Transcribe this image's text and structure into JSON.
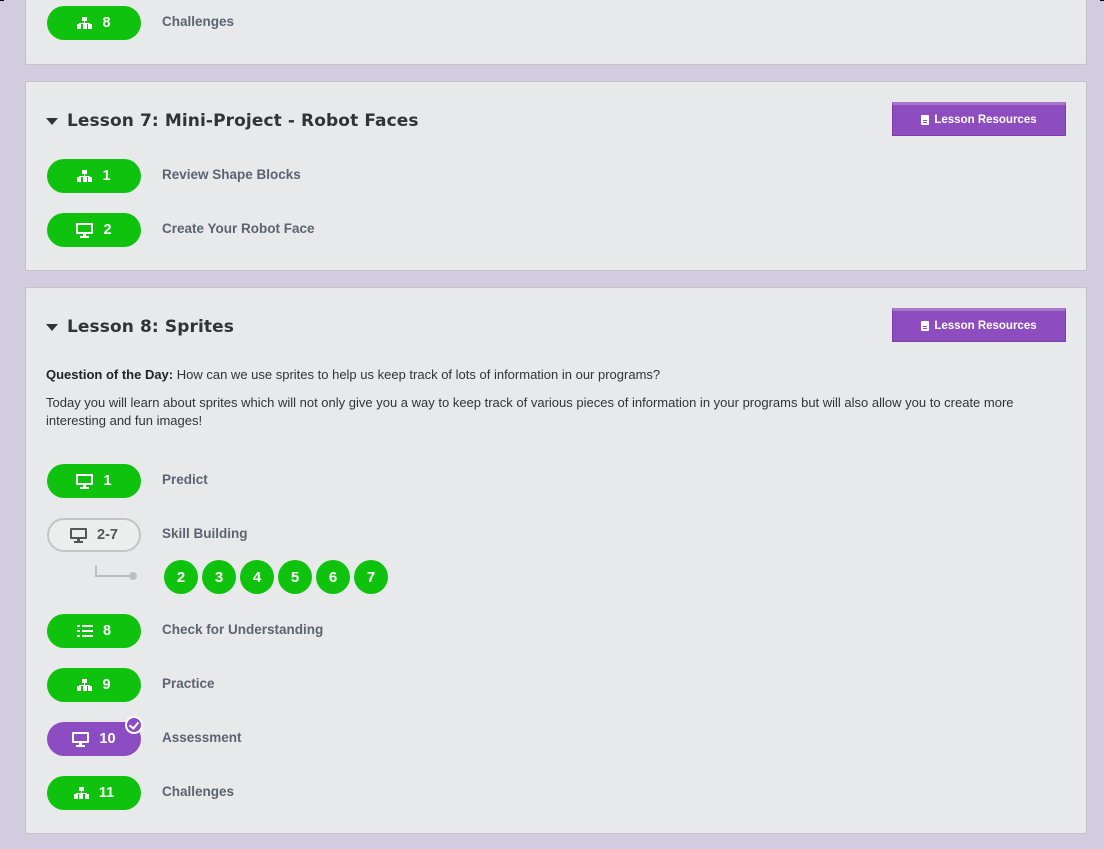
{
  "top_card": {
    "rows": [
      {
        "icon": "hierarchy-icon",
        "number": "8",
        "label": "Challenges"
      }
    ]
  },
  "lesson7": {
    "title": "Lesson 7: Mini-Project - Robot Faces",
    "resources_label": "Lesson Resources",
    "rows": [
      {
        "icon": "hierarchy-icon",
        "number": "1",
        "label": "Review Shape Blocks"
      },
      {
        "icon": "monitor-icon",
        "number": "2",
        "label": "Create Your Robot Face"
      }
    ]
  },
  "lesson8": {
    "title": "Lesson 8: Sprites",
    "resources_label": "Lesson Resources",
    "qotd_label": "Question of the Day:",
    "qotd_text": " How can we use sprites to help us keep track of lots of information in our programs?",
    "description": "Today you will learn about sprites which will not only give you a way to keep track of various pieces of information in your programs but will also allow you to create more interesting and fun images!",
    "rows": [
      {
        "icon": "monitor-icon",
        "number": "1",
        "label": "Predict"
      },
      {
        "icon": "monitor-icon",
        "number": "2-7",
        "label": "Skill Building"
      },
      {
        "icon": "list-icon",
        "number": "8",
        "label": "Check for Understanding"
      },
      {
        "icon": "hierarchy-icon",
        "number": "9",
        "label": "Practice"
      },
      {
        "icon": "monitor-icon",
        "number": "10",
        "label": "Assessment"
      },
      {
        "icon": "hierarchy-icon",
        "number": "11",
        "label": "Challenges"
      }
    ],
    "skill_building_levels": [
      "2",
      "3",
      "4",
      "5",
      "6",
      "7"
    ]
  },
  "colors": {
    "green": "#0ec20e",
    "purple": "#8c4dc2",
    "background": "#d2cce1",
    "card": "#e8e9ea"
  }
}
